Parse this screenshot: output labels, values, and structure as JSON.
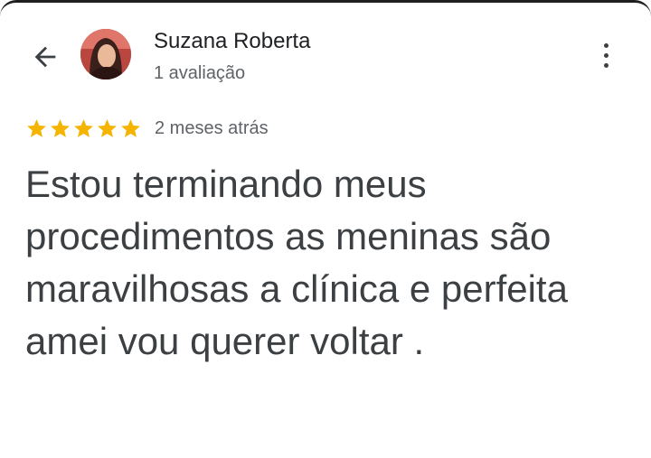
{
  "header": {
    "user_name": "Suzana Roberta",
    "review_count": "1 avaliação"
  },
  "review": {
    "rating": 5,
    "max_rating": 5,
    "date": "2 meses atrás",
    "text": "Estou terminando meus procedimentos as meninas são maravilhosas a clínica e perfeita amei vou querer voltar ."
  },
  "icons": {
    "back": "arrow-back-icon",
    "more": "more-vert-icon",
    "star": "star-icon"
  },
  "colors": {
    "star": "#f4b400",
    "text": "#3c4043",
    "secondary": "#5f6368"
  }
}
